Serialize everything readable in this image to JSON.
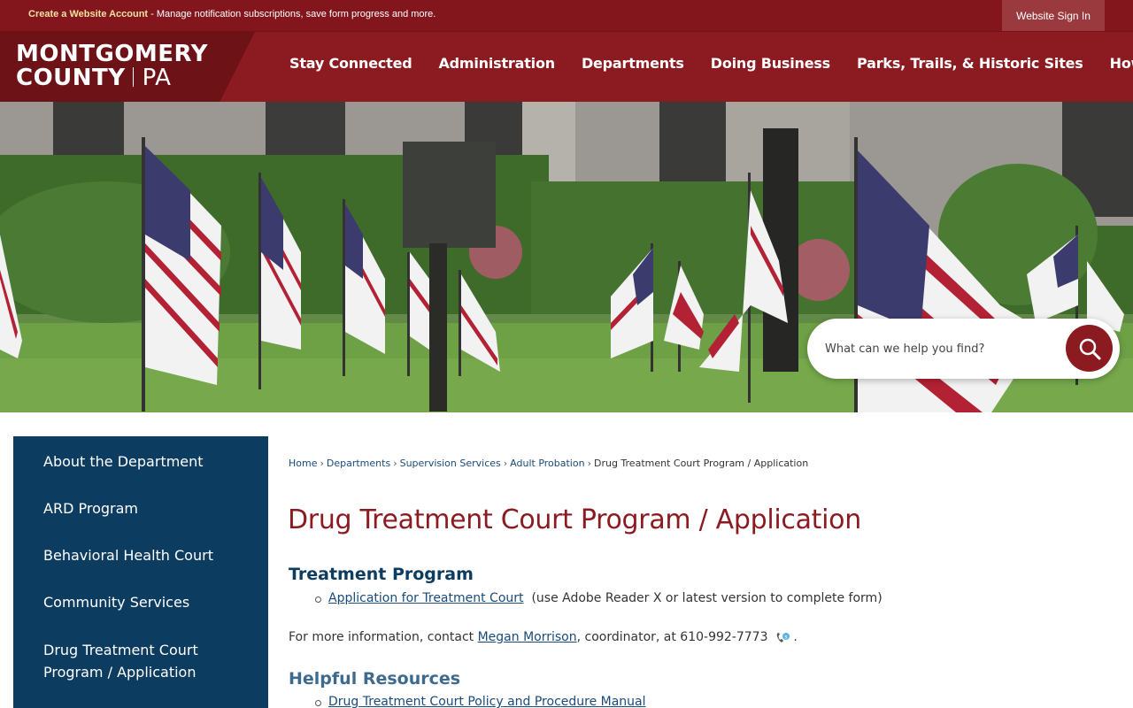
{
  "topbar": {
    "create_account_link": "Create a Website Account",
    "notice_text": " - Manage notification subscriptions, save form progress and more.",
    "signin_label": "Website Sign In"
  },
  "logo": {
    "line1": "MONTGOMERY",
    "line2": "COUNTY",
    "state": "PA"
  },
  "nav": {
    "items": [
      "Stay Connected",
      "Administration",
      "Departments",
      "Doing Business",
      "Parks, Trails, & Historic Sites",
      "How Do I?"
    ]
  },
  "search": {
    "placeholder": "What can we help you find?"
  },
  "sidebar": {
    "items": [
      {
        "label": "About the Department"
      },
      {
        "label": "ARD Program"
      },
      {
        "label": "Behavioral Health Court"
      },
      {
        "label": "Community Services"
      },
      {
        "label": "Drug Treatment Court Program / Application"
      }
    ]
  },
  "breadcrumb": {
    "items": [
      "Home",
      "Departments",
      "Supervision Services",
      "Adult Probation"
    ],
    "current": "Drug Treatment Court Program / Application",
    "separator": "›"
  },
  "main": {
    "title": "Drug Treatment Court Program / Application",
    "section1_heading": "Treatment Program",
    "section1_link": "Application for Treatment Court",
    "section1_note": "(use Adobe Reader X or latest version to complete form)",
    "info_prefix": "For more information, contact ",
    "info_contact": "Megan Morrison",
    "info_suffix": ", coordinator, at 610-992-7773",
    "info_end": ".",
    "section2_heading": "Helpful Resources",
    "section2_link": "Drug Treatment Court Policy and Procedure Manual"
  },
  "colors": {
    "brand_red": "#8b1b21",
    "sidebar_blue": "#0d3c61",
    "link_blue": "#1a4a7a"
  }
}
